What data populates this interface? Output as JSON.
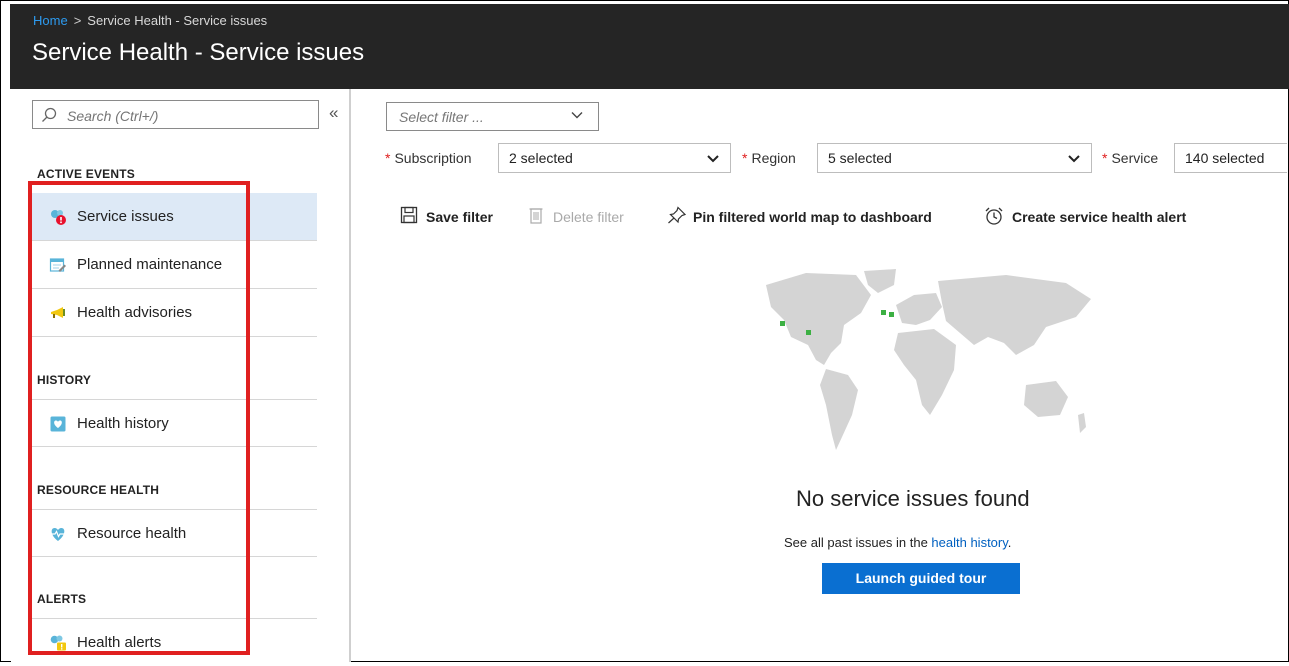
{
  "header": {
    "breadcrumb": {
      "home": "Home",
      "separator": ">",
      "current": "Service Health - Service issues"
    },
    "title": "Service Health - Service issues"
  },
  "sidebar": {
    "search": {
      "placeholder": "Search (Ctrl+/)"
    },
    "collapse_label": "«",
    "sections": [
      {
        "heading": "ACTIVE EVENTS",
        "items": [
          {
            "label": "Service issues",
            "icon": "service-issues-icon",
            "active": true
          },
          {
            "label": "Planned maintenance",
            "icon": "planned-maintenance-icon"
          },
          {
            "label": "Health advisories",
            "icon": "health-advisories-icon"
          }
        ]
      },
      {
        "heading": "HISTORY",
        "items": [
          {
            "label": "Health history",
            "icon": "health-history-icon"
          }
        ]
      },
      {
        "heading": "RESOURCE HEALTH",
        "items": [
          {
            "label": "Resource health",
            "icon": "resource-health-icon"
          }
        ]
      },
      {
        "heading": "ALERTS",
        "items": [
          {
            "label": "Health alerts",
            "icon": "health-alerts-icon"
          }
        ]
      }
    ]
  },
  "filters": {
    "select_filter_placeholder": "Select filter ...",
    "required_marker": "*",
    "subscription": {
      "label": "Subscription",
      "value": "2 selected"
    },
    "region": {
      "label": "Region",
      "value": "5 selected"
    },
    "service": {
      "label": "Service",
      "value": "140 selected"
    }
  },
  "toolbar": {
    "save": "Save filter",
    "delete": "Delete filter",
    "pin": "Pin filtered world map to dashboard",
    "alert": "Create service health alert"
  },
  "empty_state": {
    "title": "No service issues found",
    "subtitle_prefix": "See all past issues in the ",
    "subtitle_link": "health history",
    "subtitle_suffix": ".",
    "button": "Launch guided tour"
  },
  "colors": {
    "header_bg": "#252525",
    "accent": "#0a6fd1",
    "link": "#0060c0",
    "active_item_bg": "#dde9f6",
    "highlight_box": "#e02020",
    "map_marker": "#3cb043"
  }
}
